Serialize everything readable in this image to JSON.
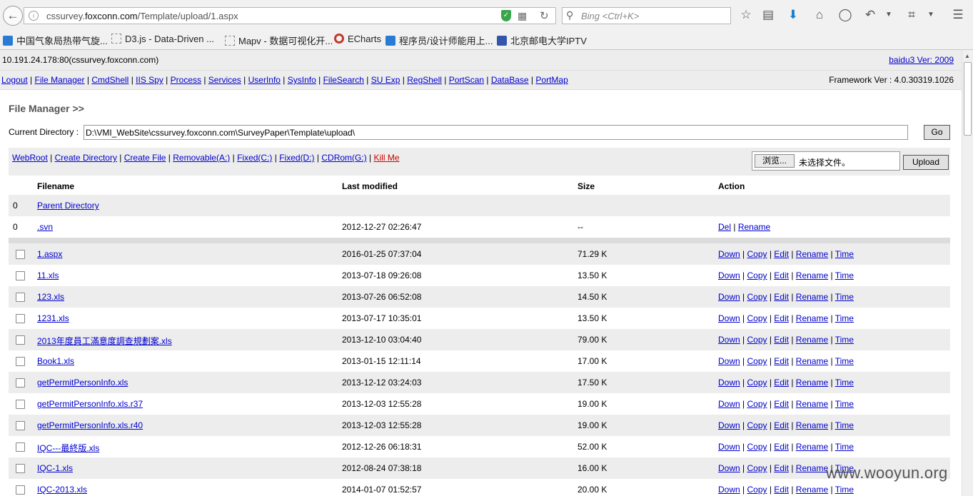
{
  "browser": {
    "url_prefix": "cssurvey.",
    "url_domain": "foxconn.com",
    "url_path": "/Template/upload/1.aspx",
    "search_placeholder": "Bing <Ctrl+K>",
    "bookmarks": [
      {
        "label": "中国气象局热带气旋...",
        "icon": "cma-icon",
        "color": "#2a7bd6"
      },
      {
        "label": "D3.js - Data-Driven ...",
        "icon": "page-icon",
        "color": "#888888"
      },
      {
        "label": "Mapv - 数据可视化开...",
        "icon": "page-icon",
        "color": "#888888"
      },
      {
        "label": "ECharts",
        "icon": "echarts-icon",
        "color": "#c0392b"
      },
      {
        "label": "程序员/设计师能用上...",
        "icon": "b-icon",
        "color": "#2a7bd6"
      },
      {
        "label": "北京邮电大学IPTV",
        "icon": "bupt-icon",
        "color": "#3355aa"
      }
    ]
  },
  "header": {
    "host": "10.191.24.178:80(cssurvey.foxconn.com)",
    "version_link": "baidu3 Ver: 2009",
    "framework": "Framework Ver : 4.0.30319.1026"
  },
  "nav": [
    "Logout",
    "File Manager",
    "CmdShell",
    "IIS Spy",
    "Process",
    "Services",
    "UserInfo",
    "SysInfo",
    "FileSearch",
    "SU Exp",
    "RegShell",
    "PortScan",
    "DataBase",
    "PortMap"
  ],
  "title": "File Manager >>",
  "current_dir": {
    "label": "Current Directory :",
    "value": "D:\\VMI_WebSite\\cssurvey.foxconn.com\\SurveyPaper\\Template\\upload\\",
    "go": "Go"
  },
  "quicklinks": [
    "WebRoot",
    "Create Directory",
    "Create File",
    "Removable(A:)",
    "Fixed(C:)",
    "Fixed(D:)",
    "CDRom(G:)"
  ],
  "kill": "Kill Me",
  "upload": {
    "browse": "浏览...",
    "no_file": "未选择文件。",
    "button": "Upload"
  },
  "table": {
    "headers": [
      "Filename",
      "Last modified",
      "Size",
      "Action"
    ],
    "dirs": [
      {
        "n": "0",
        "name": "Parent Directory",
        "modified": "",
        "size": "",
        "actions": []
      },
      {
        "n": "0",
        "name": ".svn",
        "modified": "2012-12-27 02:26:47",
        "size": "--",
        "actions": [
          "Del",
          "Rename"
        ]
      }
    ],
    "file_actions": [
      "Down",
      "Copy",
      "Edit",
      "Rename",
      "Time"
    ],
    "files": [
      {
        "name": "1.aspx",
        "modified": "2016-01-25 07:37:04",
        "size": "71.29 K"
      },
      {
        "name": "11.xls",
        "modified": "2013-07-18 09:26:08",
        "size": "13.50 K"
      },
      {
        "name": "123.xls",
        "modified": "2013-07-26 06:52:08",
        "size": "14.50 K"
      },
      {
        "name": "1231.xls",
        "modified": "2013-07-17 10:35:01",
        "size": "13.50 K"
      },
      {
        "name": "2013年度員工滿意度調查規劃案.xls",
        "modified": "2013-12-10 03:04:40",
        "size": "79.00 K"
      },
      {
        "name": "Book1.xls",
        "modified": "2013-01-15 12:11:14",
        "size": "17.00 K"
      },
      {
        "name": "getPermitPersonInfo.xls",
        "modified": "2013-12-12 03:24:03",
        "size": "17.50 K"
      },
      {
        "name": "getPermitPersonInfo.xls.r37",
        "modified": "2013-12-03 12:55:28",
        "size": "19.00 K"
      },
      {
        "name": "getPermitPersonInfo.xls.r40",
        "modified": "2013-12-03 12:55:28",
        "size": "19.00 K"
      },
      {
        "name": "IQC---最終版.xls",
        "modified": "2012-12-26 06:18:31",
        "size": "52.00 K"
      },
      {
        "name": "IQC-1.xls",
        "modified": "2012-08-24 07:38:18",
        "size": "16.00 K"
      },
      {
        "name": "IQC-2013.xls",
        "modified": "2014-01-07 01:52:57",
        "size": "20.00 K"
      }
    ]
  },
  "watermark": "www.wooyun.org"
}
